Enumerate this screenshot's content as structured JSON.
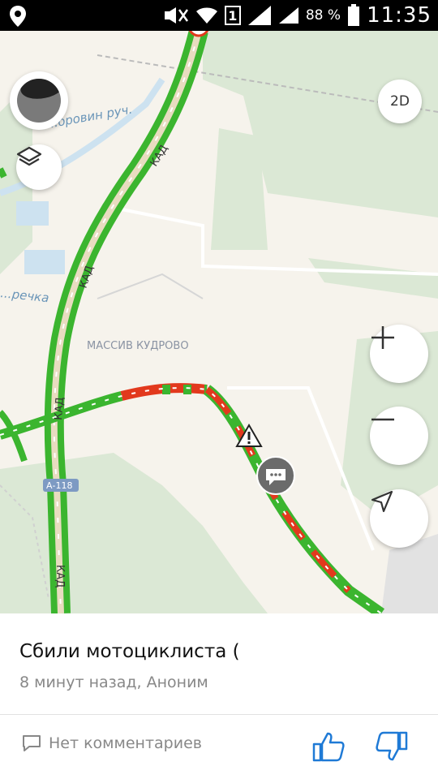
{
  "status_bar": {
    "battery_percent": "88 %",
    "time": "11:35",
    "sim_slot": "1",
    "icons": [
      "location-icon",
      "no-sound-icon",
      "wifi-icon",
      "sim-icon",
      "signal-icon",
      "battery-icon"
    ]
  },
  "map": {
    "labels": {
      "stream": "...оровин руч.",
      "river": "...речка",
      "district": "МАССИВ КУДРОВО",
      "highway_badge": "А-118",
      "road_upper": "КАД",
      "road_middle": "КАД",
      "road_lower": "КАД",
      "road_bottom": "КАД"
    },
    "colors": {
      "traffic_green": "#3bb52f",
      "traffic_red": "#e2391d",
      "land_green": "#dbe8d5",
      "water": "#cde2f0",
      "background": "#f6f3ec"
    },
    "controls": {
      "mode_label": "2D",
      "zoom_in_icon": "plus-icon",
      "zoom_out_icon": "minus-icon",
      "locate_icon": "navigation-arrow-icon",
      "layers_icon": "layers-icon"
    },
    "markers": [
      "warning-icon",
      "chat-bubble-icon"
    ]
  },
  "event_panel": {
    "title": "Сбили мотоциклиста (",
    "meta": "8 минут назад, Аноним",
    "comments_label": "Нет комментариев",
    "like_icon": "thumbs-up-icon",
    "dislike_icon": "thumbs-down-icon"
  }
}
